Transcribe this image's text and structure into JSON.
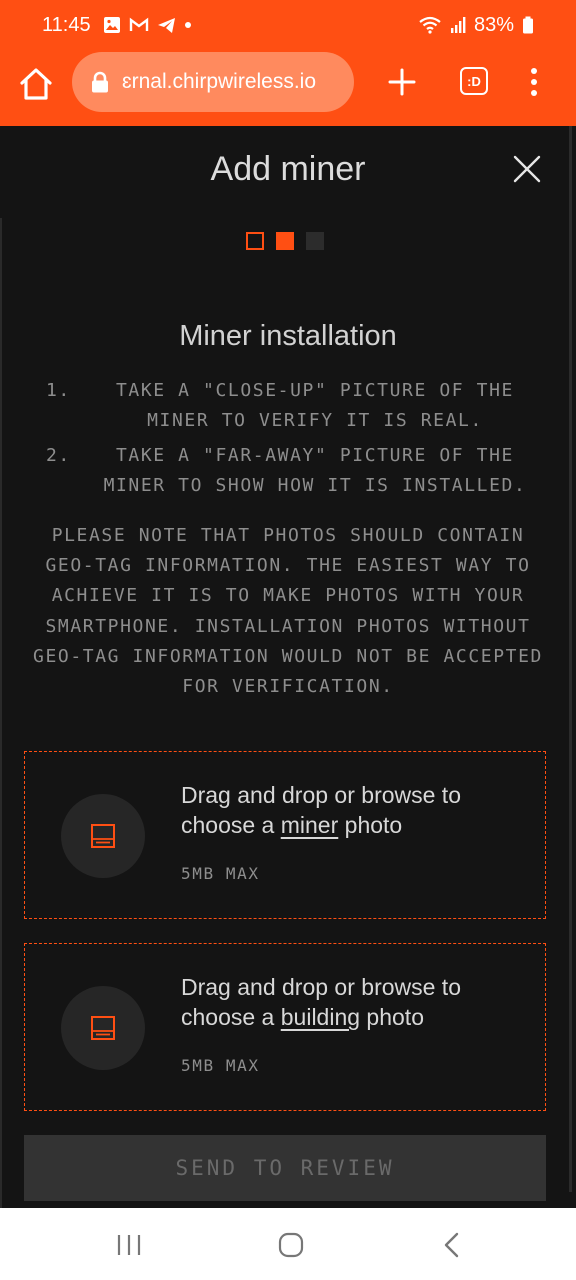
{
  "status_bar": {
    "time": "11:45",
    "battery": "83%"
  },
  "browser": {
    "url": "ɛrnal.chirpwireless.io",
    "tabs_label": ":D"
  },
  "modal": {
    "title": "Add miner",
    "progress": {
      "current_step": 2,
      "total_steps": 3
    },
    "section_title": "Miner installation",
    "instructions": [
      {
        "num": "1.",
        "text": "TAKE A \"CLOSE-UP\" PICTURE OF THE MINER TO VERIFY IT IS REAL."
      },
      {
        "num": "2.",
        "text": "TAKE A \"FAR-AWAY\" PICTURE OF THE MINER TO SHOW HOW IT IS INSTALLED."
      }
    ],
    "note": "PLEASE NOTE THAT PHOTOS SHOULD CONTAIN GEO-TAG INFORMATION. THE EASIEST WAY TO ACHIEVE IT IS TO MAKE PHOTOS WITH YOUR SMARTPHONE. INSTALLATION PHOTOS WITHOUT GEO-TAG INFORMATION WOULD NOT BE ACCEPTED FOR VERIFICATION.",
    "dropzones": [
      {
        "prefix": "Drag and drop or browse to choose a ",
        "link": "miner",
        "suffix": " photo",
        "max": "5MB MAX"
      },
      {
        "prefix": "Drag and drop or browse to choose a ",
        "link": "building",
        "suffix": " photo",
        "max": "5MB MAX"
      }
    ],
    "submit_label": "SEND TO REVIEW"
  },
  "colors": {
    "accent": "#ff4f13",
    "background": "#141414",
    "url_pill": "#ff8a5e",
    "button_disabled": "#333333"
  }
}
